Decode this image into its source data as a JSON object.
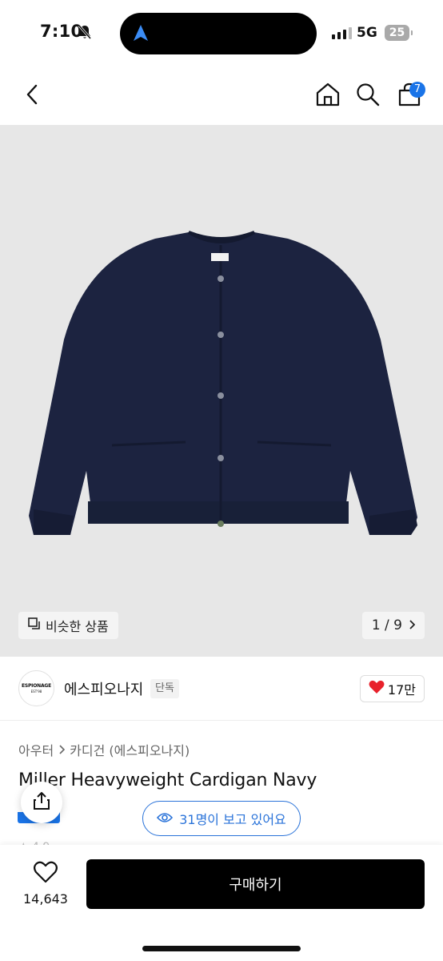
{
  "status_bar": {
    "time": "7:10",
    "network": "5G",
    "battery": "25",
    "icons": [
      "bell-slash-icon",
      "location-arrow-icon",
      "signal-icon",
      "battery-icon"
    ]
  },
  "nav": {
    "icons": [
      "back-chevron-icon",
      "home-icon",
      "search-icon",
      "cart-icon"
    ],
    "cart_count": "7"
  },
  "hero": {
    "similar_label": "비슷한 상품",
    "pager": "1 / 9",
    "background_color": "#e7e7e7",
    "product_color": "#1c2340"
  },
  "brand": {
    "logo_line1": "ESPIONAGE",
    "logo_line2": "EST'98",
    "name": "에스피오나지",
    "tag": "단독",
    "likes": "17만"
  },
  "product": {
    "category_main": "아우터",
    "category_sub": "카디건 (에스피오나지)",
    "title": "Miller Heavyweight Cardigan Navy",
    "viewers": "31명이 보고 있어요"
  },
  "bottom": {
    "wish_count": "14,643",
    "buy_label": "구매하기"
  },
  "colors": {
    "accent_blue": "#1a74e8",
    "heart_red": "#e8212b",
    "buy_button": "#000000"
  }
}
